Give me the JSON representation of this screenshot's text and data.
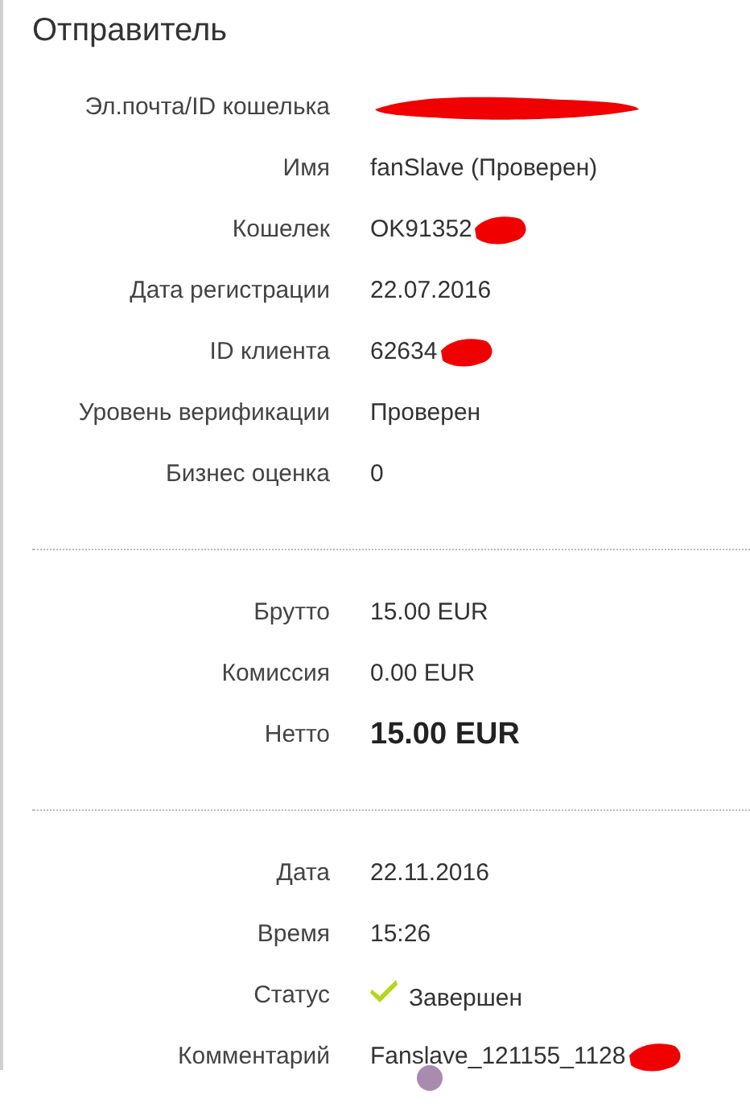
{
  "title": "Отправитель",
  "sections": [
    {
      "rows": [
        {
          "label": "Эл.почта/ID кошелька",
          "kind": "text",
          "redacted": true
        },
        {
          "label": "Имя",
          "kind": "text",
          "value": "fanSlave (Проверен)",
          "redacted": false
        },
        {
          "label": "Кошелек",
          "kind": "text",
          "value": "OK91352",
          "redacted": true
        },
        {
          "label": "Дата регистрации",
          "kind": "text",
          "value": "22.07.2016",
          "redacted": false
        },
        {
          "label": "ID клиента",
          "kind": "text",
          "value": "62634",
          "redacted": true
        },
        {
          "label": "Уровень верификации",
          "kind": "text",
          "value": "Проверен",
          "redacted": false
        },
        {
          "label": "Бизнес оценка",
          "kind": "text",
          "value": "0",
          "redacted": false
        }
      ]
    },
    {
      "rows": [
        {
          "label": "Брутто",
          "kind": "text",
          "value": "15.00 EUR",
          "redacted": false
        },
        {
          "label": "Комиссия",
          "kind": "text",
          "value": "0.00 EUR",
          "redacted": false
        },
        {
          "label": "Нетто",
          "kind": "total",
          "value": "15.00 EUR",
          "redacted": false
        }
      ]
    },
    {
      "rows": [
        {
          "label": "Дата",
          "kind": "text",
          "value": "22.11.2016",
          "redacted": false
        },
        {
          "label": "Время",
          "kind": "text",
          "value": "15:26",
          "redacted": false
        },
        {
          "label": "Статус",
          "kind": "status",
          "value": "Завершен",
          "redacted": false
        },
        {
          "label": "Комментарий",
          "kind": "text",
          "value": "Fanslave_121155_1128",
          "redacted": true
        }
      ]
    }
  ]
}
